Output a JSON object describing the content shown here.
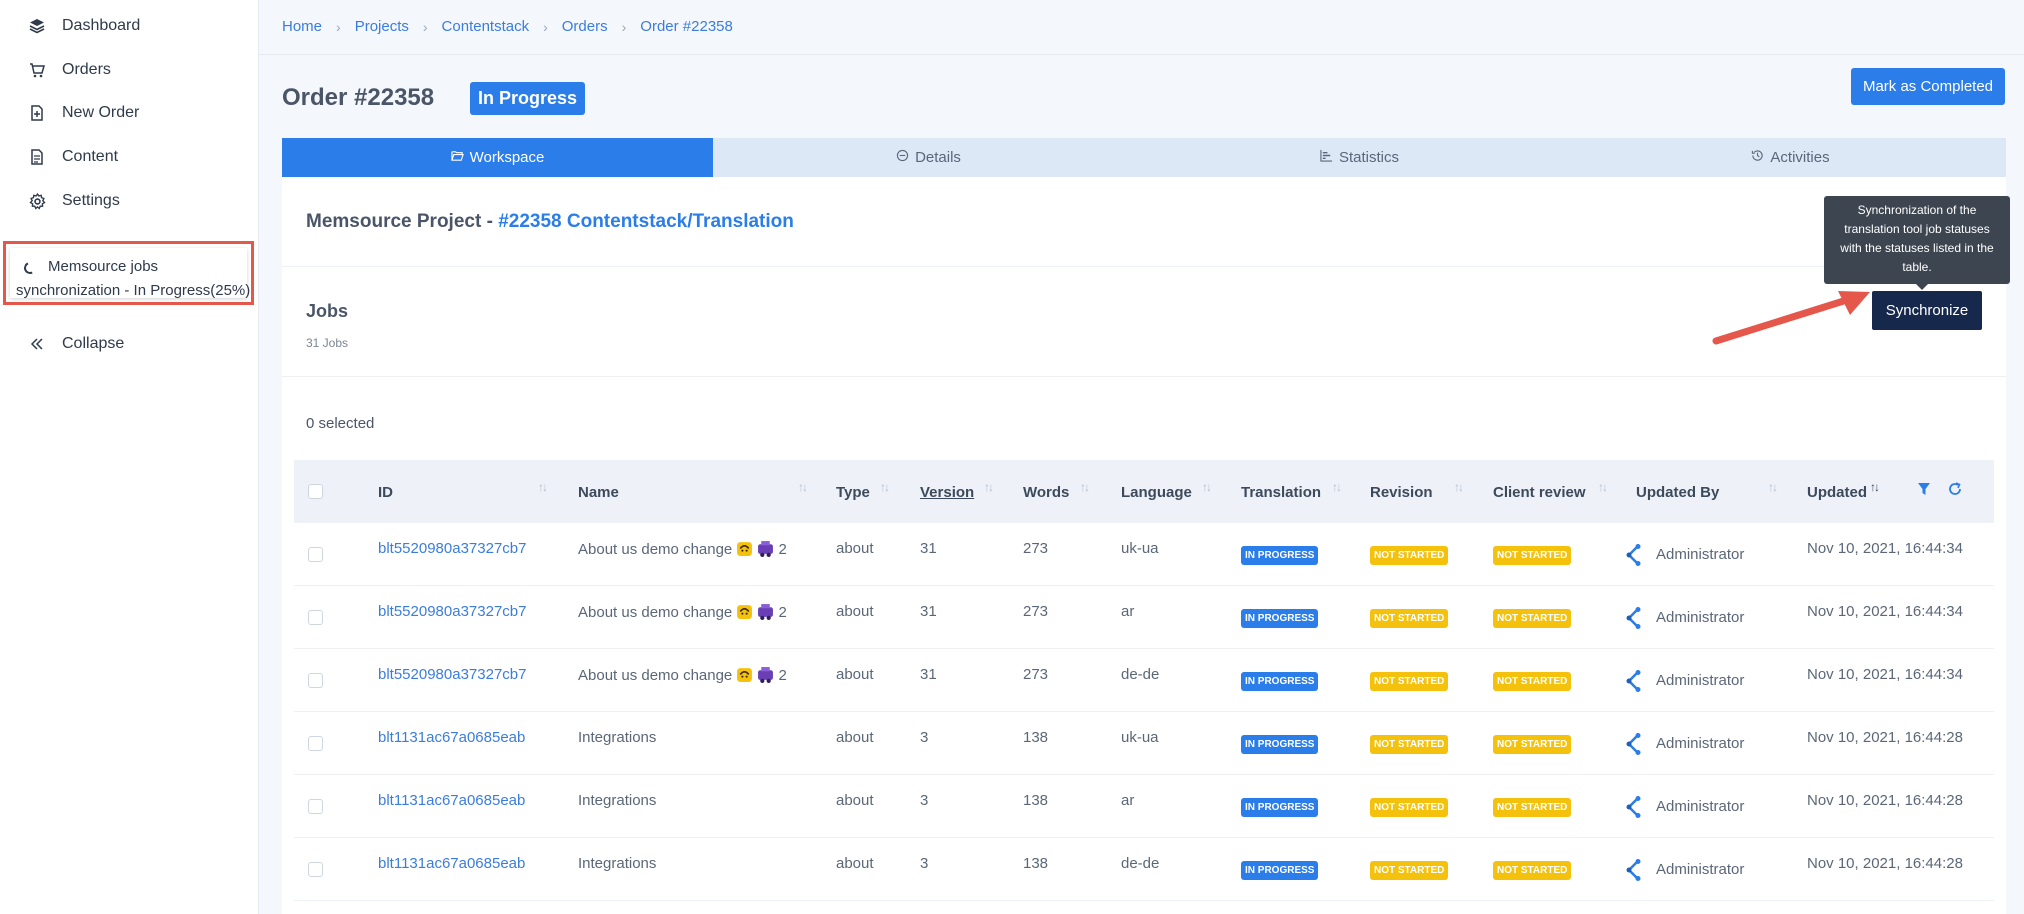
{
  "sidebar": {
    "items": [
      {
        "label": "Dashboard",
        "icon": "layers-icon"
      },
      {
        "label": "Orders",
        "icon": "cart-icon"
      },
      {
        "label": "New Order",
        "icon": "file-plus-icon"
      },
      {
        "label": "Content",
        "icon": "file-text-icon"
      },
      {
        "label": "Settings",
        "icon": "gear-icon"
      }
    ],
    "sync_status": {
      "line1": "Memsource jobs",
      "line2": "synchronization - In Progress(25%)"
    },
    "collapse_label": "Collapse"
  },
  "breadcrumb": [
    "Home",
    "Projects",
    "Contentstack",
    "Orders",
    "Order #22358"
  ],
  "header": {
    "title": "Order #22358",
    "status": "In Progress",
    "mark_completed": "Mark as Completed"
  },
  "tabs": [
    {
      "label": "Workspace",
      "icon": "folder-open-icon"
    },
    {
      "label": "Details",
      "icon": "minus-circle-icon"
    },
    {
      "label": "Statistics",
      "icon": "chart-icon"
    },
    {
      "label": "Activities",
      "icon": "history-icon"
    }
  ],
  "project": {
    "prefix": "Memsource Project -",
    "link": "#22358 Contentstack/Translation"
  },
  "jobs": {
    "title": "Jobs",
    "count": "31 Jobs",
    "selected": "0 selected"
  },
  "tooltip": "Synchronization of the translation tool job statuses with the statuses listed in the table.",
  "sync_button": "Synchronize",
  "table": {
    "headers": [
      "ID",
      "Name",
      "Type",
      "Version",
      "Words",
      "Language",
      "Translation",
      "Revision",
      "Client review",
      "Updated By",
      "Updated"
    ],
    "rows": [
      {
        "id": "blt5520980a37327cb7",
        "name": "About us demo change",
        "name_suffix": "2",
        "emoji": true,
        "type": "about",
        "version": "31",
        "words": "273",
        "language": "uk-ua",
        "translation": "IN PROGRESS",
        "revision": "NOT STARTED",
        "client_review": "NOT STARTED",
        "updated_by": "Administrator",
        "updated": "Nov 10, 2021, 16:44:34"
      },
      {
        "id": "blt5520980a37327cb7",
        "name": "About us demo change",
        "name_suffix": "2",
        "emoji": true,
        "type": "about",
        "version": "31",
        "words": "273",
        "language": "ar",
        "translation": "IN PROGRESS",
        "revision": "NOT STARTED",
        "client_review": "NOT STARTED",
        "updated_by": "Administrator",
        "updated": "Nov 10, 2021, 16:44:34"
      },
      {
        "id": "blt5520980a37327cb7",
        "name": "About us demo change",
        "name_suffix": "2",
        "emoji": true,
        "type": "about",
        "version": "31",
        "words": "273",
        "language": "de-de",
        "translation": "IN PROGRESS",
        "revision": "NOT STARTED",
        "client_review": "NOT STARTED",
        "updated_by": "Administrator",
        "updated": "Nov 10, 2021, 16:44:34"
      },
      {
        "id": "blt1131ac67a0685eab",
        "name": "Integrations",
        "name_suffix": "",
        "emoji": false,
        "type": "about",
        "version": "3",
        "words": "138",
        "language": "uk-ua",
        "translation": "IN PROGRESS",
        "revision": "NOT STARTED",
        "client_review": "NOT STARTED",
        "updated_by": "Administrator",
        "updated": "Nov 10, 2021, 16:44:28"
      },
      {
        "id": "blt1131ac67a0685eab",
        "name": "Integrations",
        "name_suffix": "",
        "emoji": false,
        "type": "about",
        "version": "3",
        "words": "138",
        "language": "ar",
        "translation": "IN PROGRESS",
        "revision": "NOT STARTED",
        "client_review": "NOT STARTED",
        "updated_by": "Administrator",
        "updated": "Nov 10, 2021, 16:44:28"
      },
      {
        "id": "blt1131ac67a0685eab",
        "name": "Integrations",
        "name_suffix": "",
        "emoji": false,
        "type": "about",
        "version": "3",
        "words": "138",
        "language": "de-de",
        "translation": "IN PROGRESS",
        "revision": "NOT STARTED",
        "client_review": "NOT STARTED",
        "updated_by": "Administrator",
        "updated": "Nov 10, 2021, 16:44:28"
      }
    ]
  },
  "colors": {
    "primary": "#2b7de9",
    "dark": "#16294d",
    "warning": "#f4c20d",
    "highlight": "#e5574a"
  }
}
